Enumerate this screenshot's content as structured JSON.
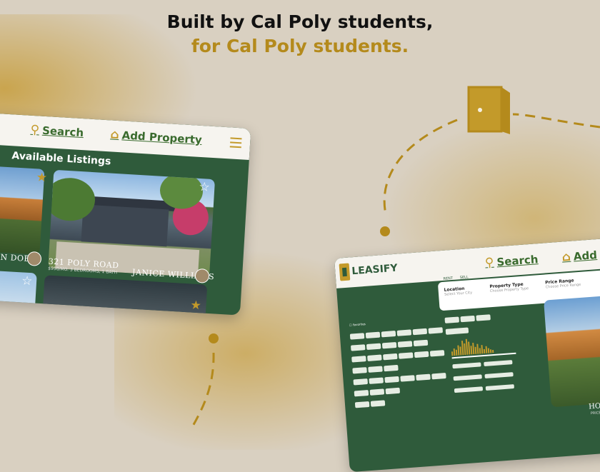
{
  "headline": {
    "line1": "Built by Cal Poly students,",
    "line2": "for Cal Poly students."
  },
  "colors": {
    "background": "#d9d0c1",
    "accent": "#b48a1c",
    "brand_green": "#2f5b3b"
  },
  "mobile": {
    "nav": {
      "search_label": "Search",
      "search_icon": "search-icon",
      "add_label": "Add Property",
      "add_icon": "house-plus-icon",
      "menu_icon": "hamburger-icon"
    },
    "section_title": "Available Listings",
    "listings": [
      {
        "title": "JOHN DOE"
      },
      {
        "title": "321 POLY ROAD",
        "subtitle": "$950/MO. 3 BEDROOMS, 1 BATH",
        "owner": "JANICE WILLIAMS"
      }
    ]
  },
  "desktop": {
    "logo": "LEASIFY",
    "nav": {
      "search_label": "Search",
      "add_label": "Add"
    },
    "tabs": [
      "RENT",
      "SELL"
    ],
    "search": {
      "location_label": "Location",
      "location_placeholder": "Select Your City",
      "type_label": "Property Type",
      "type_placeholder": "Choose Property Type",
      "price_label": "Price Range",
      "price_placeholder": "Choose Price Range"
    },
    "filters_title": "Favorites",
    "featured": {
      "title": "HOUSE",
      "subtitle": "PRICE BEDRO"
    }
  }
}
